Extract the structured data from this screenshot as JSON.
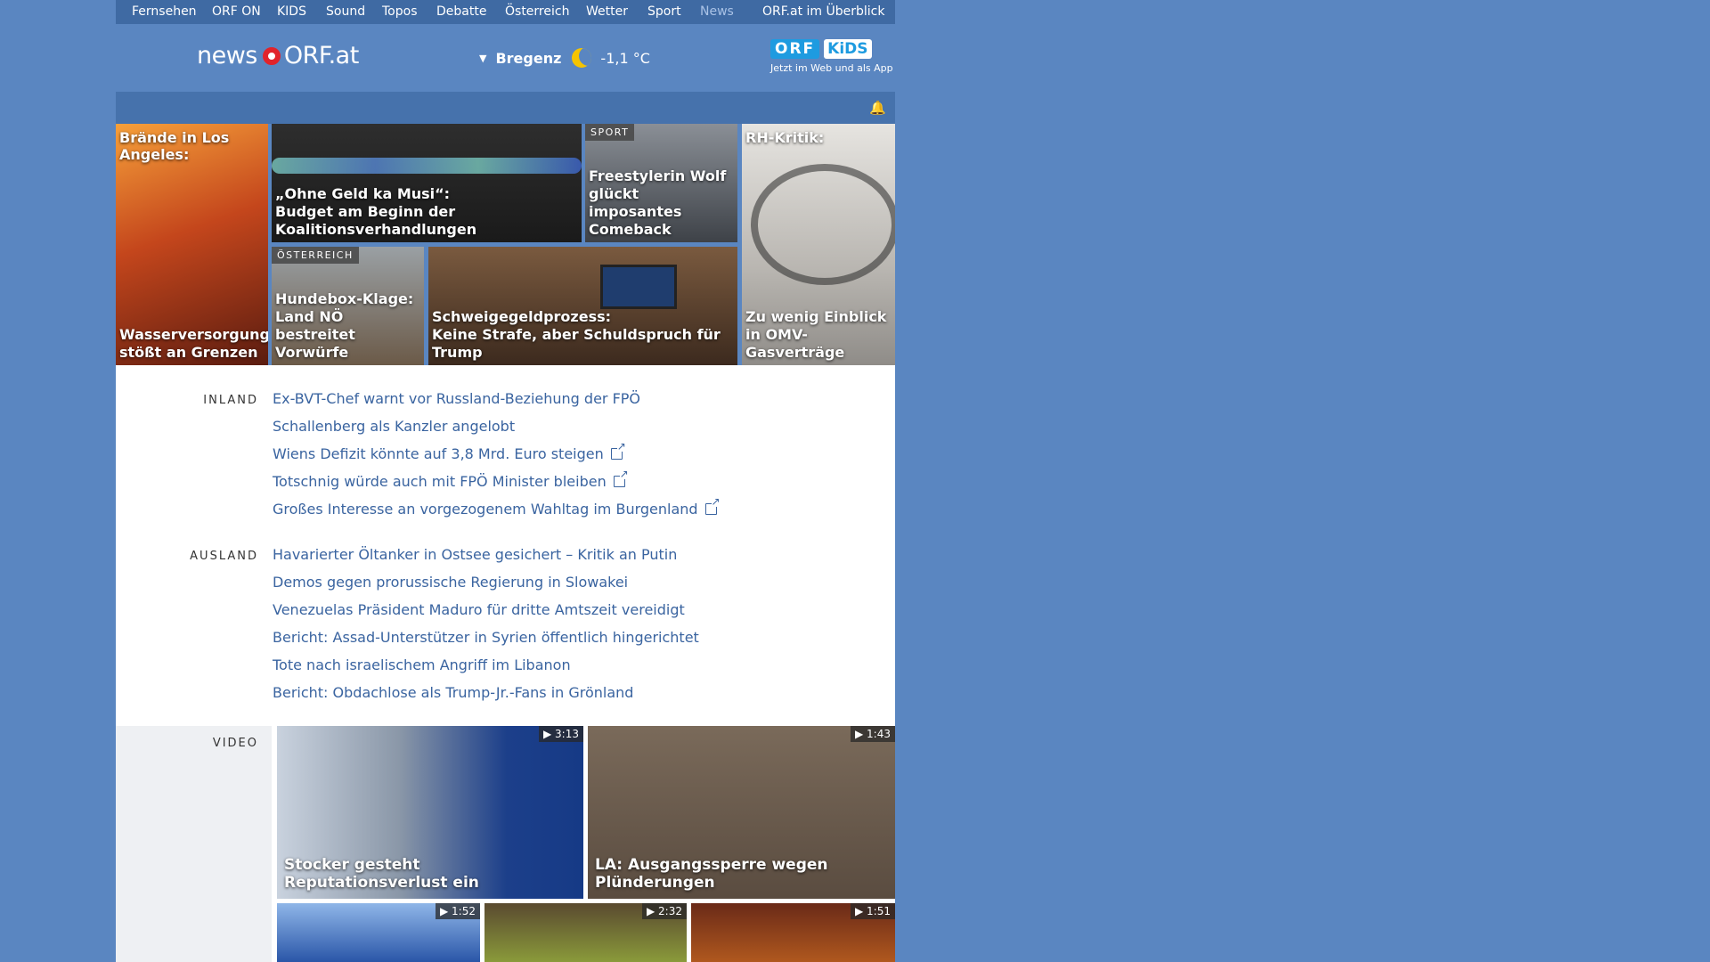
{
  "nav": {
    "items": [
      "Fernsehen",
      "ORF ON",
      "KIDS",
      "Sound",
      "Topos",
      "Debatte",
      "Österreich",
      "Wetter",
      "Sport",
      "News"
    ],
    "overview": "ORF.at im Überblick",
    "active": "News"
  },
  "header": {
    "logo_news": "news",
    "logo_orf": "ORF.at",
    "weather_city": "Bregenz",
    "weather_temp": "-1,1 °C",
    "kids_orf": "ORF",
    "kids_kids": "KiDS",
    "kids_tagline": "Jetzt im Web und als App"
  },
  "tiles": {
    "t1_top": "Brände in Los Angeles:",
    "t1_cap": "Wasserversorgung stößt an Grenzen",
    "t2_cap_1": "„Ohne Geld ka Musi“:",
    "t2_cap_2": "Budget am Beginn der Koalitionsverhandlungen",
    "t3_label": "SPORT",
    "t3_cap": "Freestylerin Wolf glückt imposantes Comeback",
    "t4_top": "RH-Kritik:",
    "t4_cap": "Zu wenig Einblick in OMV-Gasverträge",
    "t5_label": "ÖSTERREICH",
    "t5_cap": "Hundebox-Klage: Land NÖ bestreitet Vorwürfe",
    "t6_cap_1": "Schweigegeldprozess:",
    "t6_cap_2": "Keine Strafe, aber Schuldspruch für Trump"
  },
  "inland": {
    "title": "INLAND",
    "items": [
      "Ex-BVT-Chef warnt vor Russland-Beziehung der FPÖ",
      "Schallenberg als Kanzler angelobt",
      "Wiens Defizit könnte auf 3,8 Mrd. Euro steigen",
      "Totschnig würde auch mit FPÖ Minister bleiben",
      "Großes Interesse an vorgezogenem Wahltag im Burgenland"
    ]
  },
  "ausland": {
    "title": "AUSLAND",
    "items": [
      "Havarierter Öltanker in Ostsee gesichert – Kritik an Putin",
      "Demos gegen prorussische Regierung in Slowakei",
      "Venezuelas Präsident Maduro für dritte Amtszeit vereidigt",
      "Bericht: Assad-Unterstützer in Syrien öffentlich hingerichtet",
      "Tote nach israelischem Angriff im Libanon",
      "Bericht: Obdachlose als Trump-Jr.-Fans in Grönland"
    ]
  },
  "video": {
    "title": "VIDEO",
    "items": [
      {
        "caption": "Stocker gesteht Reputationsverlust ein",
        "duration": "▶ 3:13"
      },
      {
        "caption": "LA: Ausgangssperre wegen Plünderungen",
        "duration": "▶ 1:43"
      },
      {
        "caption": "",
        "duration": "▶ 1:52"
      },
      {
        "caption": "",
        "duration": "▶ 2:32"
      },
      {
        "caption": "",
        "duration": "▶ 1:51"
      }
    ]
  }
}
